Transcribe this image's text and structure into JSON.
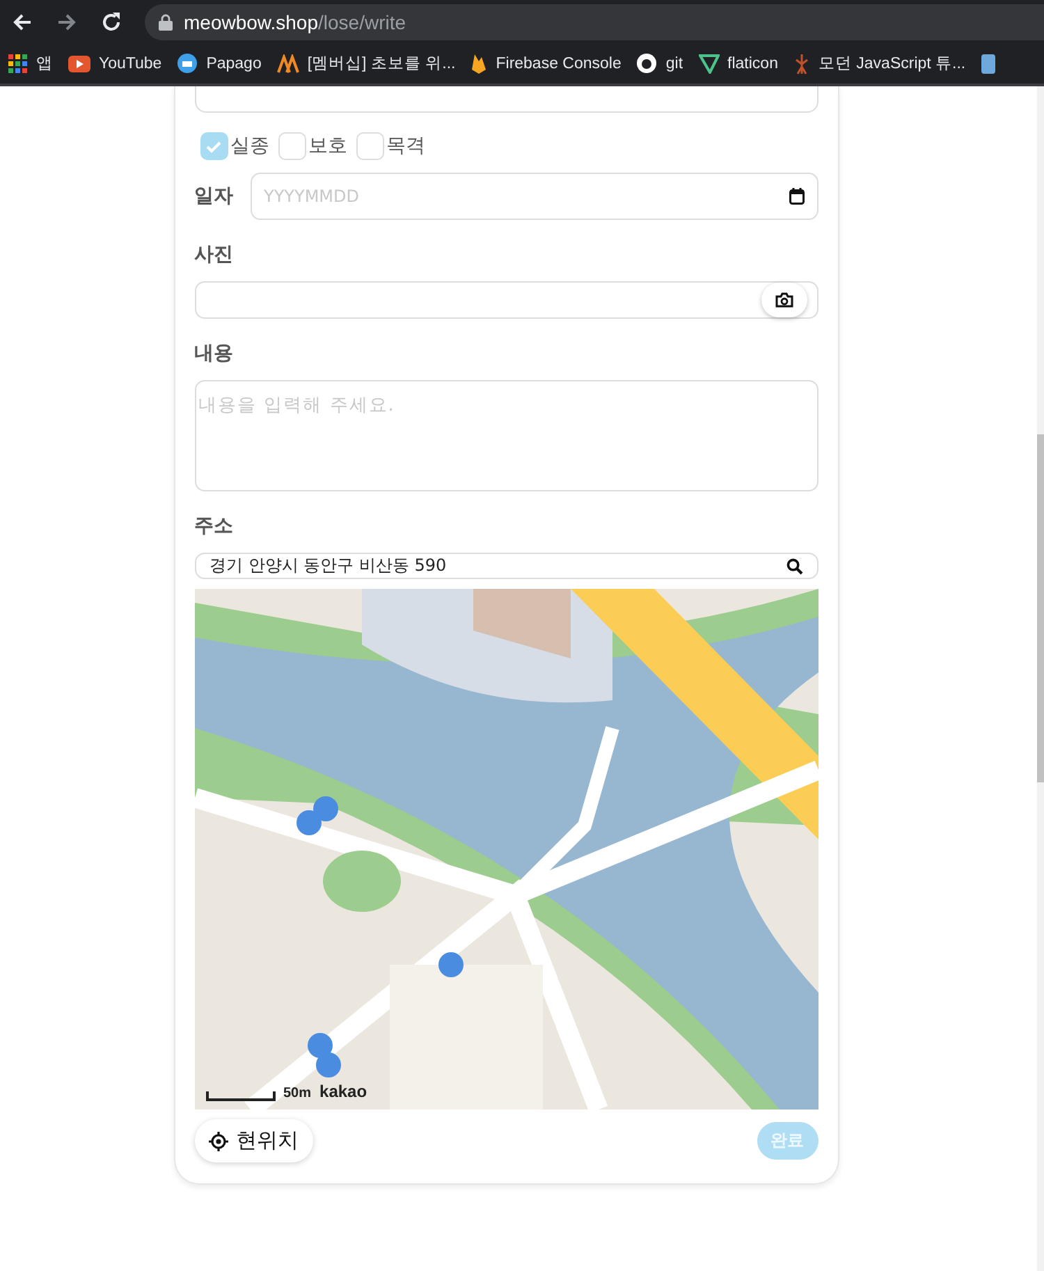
{
  "browser": {
    "url_host": "meowbow.shop",
    "url_path": "/lose/write",
    "bookmarks": [
      {
        "kind": "apps",
        "label": "앱"
      },
      {
        "kind": "youtube",
        "label": "YouTube"
      },
      {
        "kind": "papago",
        "label": "Papago"
      },
      {
        "kind": "warning",
        "label": "[멤버십] 초보를 위..."
      },
      {
        "kind": "flame",
        "label": "Firebase Console"
      },
      {
        "kind": "github",
        "label": "git"
      },
      {
        "kind": "flaticon",
        "label": "flaticon"
      },
      {
        "kind": "figure",
        "label": "모던 JavaScript 튜..."
      },
      {
        "kind": "tile"
      }
    ]
  },
  "form": {
    "types": [
      {
        "label": "실종",
        "checked": true
      },
      {
        "label": "보호",
        "checked": false
      },
      {
        "label": "목격",
        "checked": false
      }
    ],
    "date": {
      "label": "일자",
      "placeholder": "YYYYMMDD"
    },
    "photo": {
      "label": "사진"
    },
    "content": {
      "label": "내용",
      "placeholder": "내용을 입력해 주세요."
    },
    "address": {
      "label": "주소",
      "value": "경기 안양시 동안구 비산동 590"
    },
    "map": {
      "scale": "50m",
      "logo": "kakao"
    },
    "location_button": "현위치",
    "submit": {
      "label": "완료",
      "disabled": true
    }
  }
}
